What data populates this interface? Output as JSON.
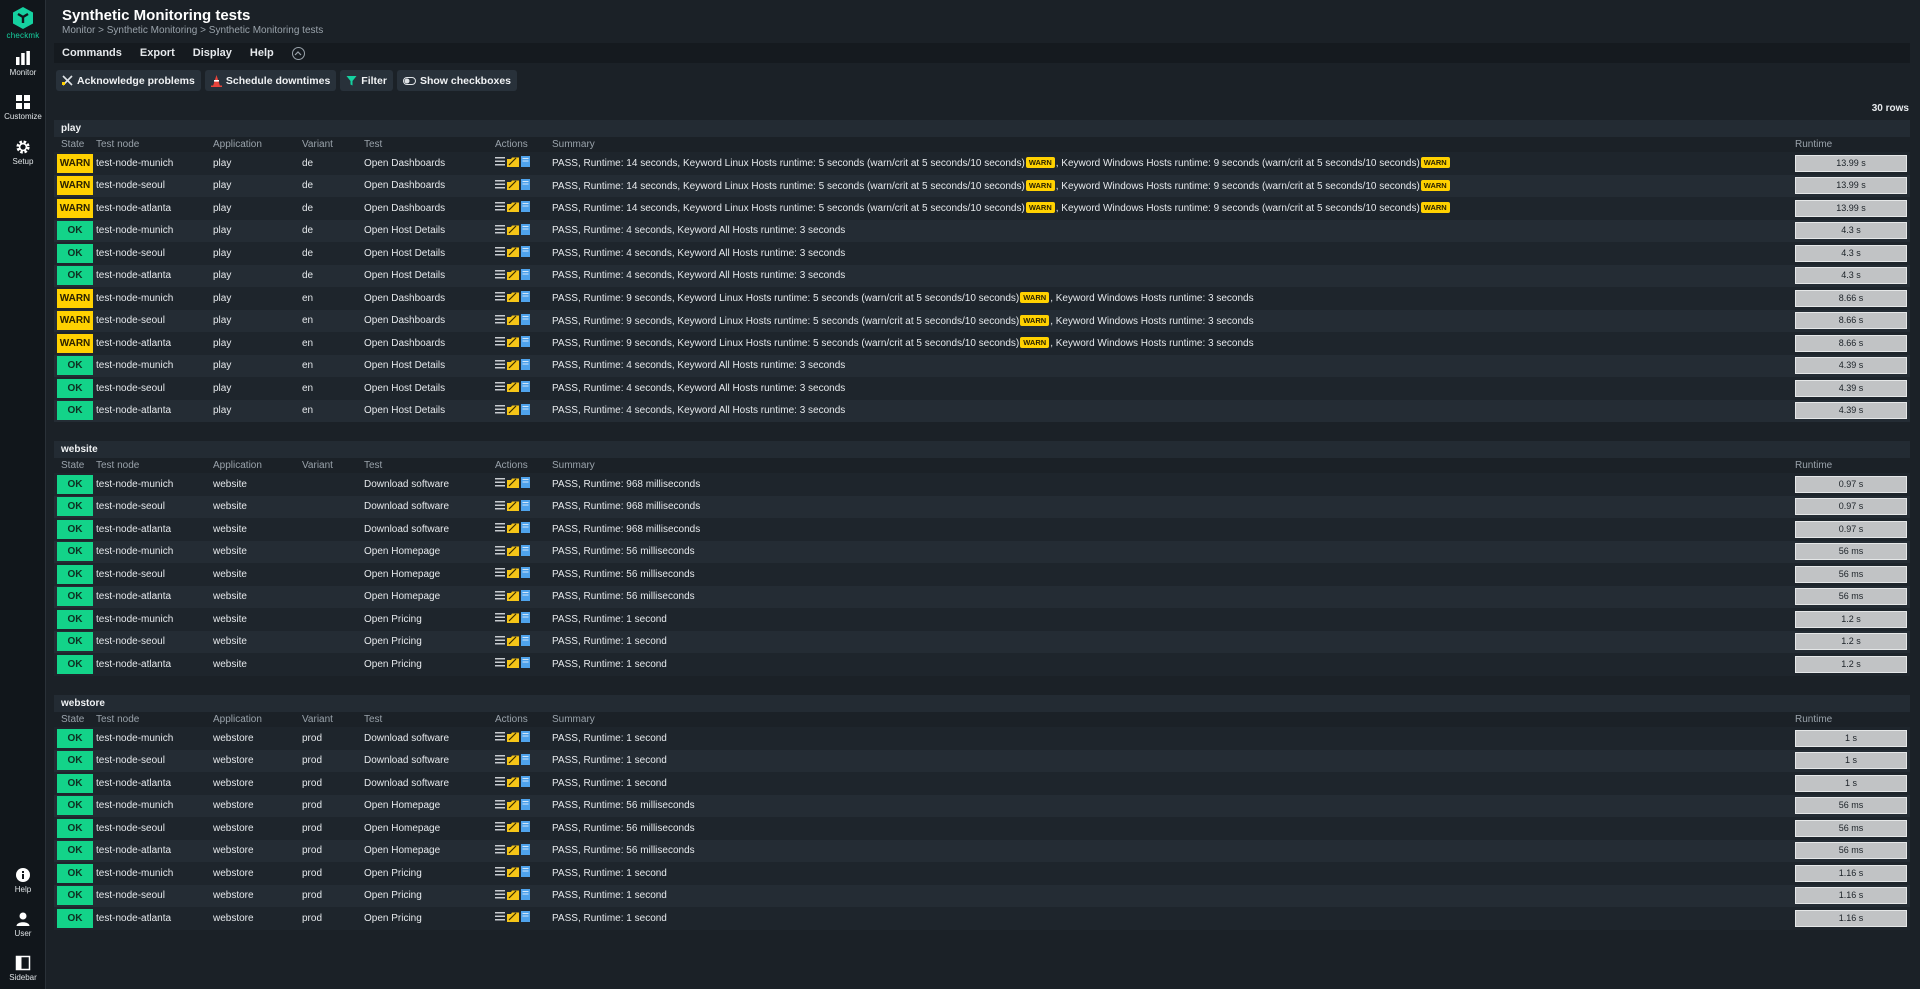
{
  "nav": {
    "logo_text": "checkmk",
    "items": [
      {
        "label": "Monitor"
      },
      {
        "label": "Customize"
      },
      {
        "label": "Setup"
      }
    ],
    "bottom_items": [
      {
        "label": "Help"
      },
      {
        "label": "User"
      },
      {
        "label": "Sidebar"
      }
    ]
  },
  "header": {
    "title": "Synthetic Monitoring tests",
    "breadcrumb": [
      "Monitor",
      "Synthetic Monitoring",
      "Synthetic Monitoring tests"
    ]
  },
  "menubar": [
    "Commands",
    "Export",
    "Display",
    "Help"
  ],
  "toolbar": [
    {
      "label": "Acknowledge problems",
      "icon": "acknowledge-icon"
    },
    {
      "label": "Schedule downtimes",
      "icon": "downtime-cone-icon"
    },
    {
      "label": "Filter",
      "icon": "filter-icon"
    },
    {
      "label": "Show checkboxes",
      "icon": "toggle-icon"
    }
  ],
  "row_count": "30 rows",
  "columns": [
    "State",
    "Test node",
    "Application",
    "Variant",
    "Test",
    "Actions",
    "Summary",
    "Runtime"
  ],
  "colors": {
    "ok": "#13d389",
    "warn": "#ffd100",
    "accent": "#15d1a0"
  },
  "groups": [
    {
      "name": "play",
      "rows": [
        {
          "state": "WARN",
          "node": "test-node-munich",
          "app": "play",
          "variant": "de",
          "test": "Open Dashboards",
          "summary": [
            "PASS, Runtime: 14 seconds, Keyword Linux Hosts runtime: 5 seconds (warn/crit at 5 seconds/10 seconds)",
            "WARN",
            ", Keyword Windows Hosts runtime: 9 seconds (warn/crit at 5 seconds/10 seconds)",
            "WARN"
          ],
          "runtime": "13.99 s"
        },
        {
          "state": "WARN",
          "node": "test-node-seoul",
          "app": "play",
          "variant": "de",
          "test": "Open Dashboards",
          "summary": [
            "PASS, Runtime: 14 seconds, Keyword Linux Hosts runtime: 5 seconds (warn/crit at 5 seconds/10 seconds)",
            "WARN",
            ", Keyword Windows Hosts runtime: 9 seconds (warn/crit at 5 seconds/10 seconds)",
            "WARN"
          ],
          "runtime": "13.99 s"
        },
        {
          "state": "WARN",
          "node": "test-node-atlanta",
          "app": "play",
          "variant": "de",
          "test": "Open Dashboards",
          "summary": [
            "PASS, Runtime: 14 seconds, Keyword Linux Hosts runtime: 5 seconds (warn/crit at 5 seconds/10 seconds)",
            "WARN",
            ", Keyword Windows Hosts runtime: 9 seconds (warn/crit at 5 seconds/10 seconds)",
            "WARN"
          ],
          "runtime": "13.99 s"
        },
        {
          "state": "OK",
          "node": "test-node-munich",
          "app": "play",
          "variant": "de",
          "test": "Open Host Details",
          "summary": [
            "PASS, Runtime: 4 seconds, Keyword All Hosts runtime: 3 seconds"
          ],
          "runtime": "4.3 s"
        },
        {
          "state": "OK",
          "node": "test-node-seoul",
          "app": "play",
          "variant": "de",
          "test": "Open Host Details",
          "summary": [
            "PASS, Runtime: 4 seconds, Keyword All Hosts runtime: 3 seconds"
          ],
          "runtime": "4.3 s"
        },
        {
          "state": "OK",
          "node": "test-node-atlanta",
          "app": "play",
          "variant": "de",
          "test": "Open Host Details",
          "summary": [
            "PASS, Runtime: 4 seconds, Keyword All Hosts runtime: 3 seconds"
          ],
          "runtime": "4.3 s"
        },
        {
          "state": "WARN",
          "node": "test-node-munich",
          "app": "play",
          "variant": "en",
          "test": "Open Dashboards",
          "summary": [
            "PASS, Runtime: 9 seconds, Keyword Linux Hosts runtime: 5 seconds (warn/crit at 5 seconds/10 seconds)",
            "WARN",
            ", Keyword Windows Hosts runtime: 3 seconds"
          ],
          "runtime": "8.66 s"
        },
        {
          "state": "WARN",
          "node": "test-node-seoul",
          "app": "play",
          "variant": "en",
          "test": "Open Dashboards",
          "summary": [
            "PASS, Runtime: 9 seconds, Keyword Linux Hosts runtime: 5 seconds (warn/crit at 5 seconds/10 seconds)",
            "WARN",
            ", Keyword Windows Hosts runtime: 3 seconds"
          ],
          "runtime": "8.66 s"
        },
        {
          "state": "WARN",
          "node": "test-node-atlanta",
          "app": "play",
          "variant": "en",
          "test": "Open Dashboards",
          "summary": [
            "PASS, Runtime: 9 seconds, Keyword Linux Hosts runtime: 5 seconds (warn/crit at 5 seconds/10 seconds)",
            "WARN",
            ", Keyword Windows Hosts runtime: 3 seconds"
          ],
          "runtime": "8.66 s"
        },
        {
          "state": "OK",
          "node": "test-node-munich",
          "app": "play",
          "variant": "en",
          "test": "Open Host Details",
          "summary": [
            "PASS, Runtime: 4 seconds, Keyword All Hosts runtime: 3 seconds"
          ],
          "runtime": "4.39 s"
        },
        {
          "state": "OK",
          "node": "test-node-seoul",
          "app": "play",
          "variant": "en",
          "test": "Open Host Details",
          "summary": [
            "PASS, Runtime: 4 seconds, Keyword All Hosts runtime: 3 seconds"
          ],
          "runtime": "4.39 s"
        },
        {
          "state": "OK",
          "node": "test-node-atlanta",
          "app": "play",
          "variant": "en",
          "test": "Open Host Details",
          "summary": [
            "PASS, Runtime: 4 seconds, Keyword All Hosts runtime: 3 seconds"
          ],
          "runtime": "4.39 s"
        }
      ]
    },
    {
      "name": "website",
      "rows": [
        {
          "state": "OK",
          "node": "test-node-munich",
          "app": "website",
          "variant": "",
          "test": "Download software",
          "summary": [
            "PASS, Runtime: 968 milliseconds"
          ],
          "runtime": "0.97 s"
        },
        {
          "state": "OK",
          "node": "test-node-seoul",
          "app": "website",
          "variant": "",
          "test": "Download software",
          "summary": [
            "PASS, Runtime: 968 milliseconds"
          ],
          "runtime": "0.97 s"
        },
        {
          "state": "OK",
          "node": "test-node-atlanta",
          "app": "website",
          "variant": "",
          "test": "Download software",
          "summary": [
            "PASS, Runtime: 968 milliseconds"
          ],
          "runtime": "0.97 s"
        },
        {
          "state": "OK",
          "node": "test-node-munich",
          "app": "website",
          "variant": "",
          "test": "Open Homepage",
          "summary": [
            "PASS, Runtime: 56 milliseconds"
          ],
          "runtime": "56 ms"
        },
        {
          "state": "OK",
          "node": "test-node-seoul",
          "app": "website",
          "variant": "",
          "test": "Open Homepage",
          "summary": [
            "PASS, Runtime: 56 milliseconds"
          ],
          "runtime": "56 ms"
        },
        {
          "state": "OK",
          "node": "test-node-atlanta",
          "app": "website",
          "variant": "",
          "test": "Open Homepage",
          "summary": [
            "PASS, Runtime: 56 milliseconds"
          ],
          "runtime": "56 ms"
        },
        {
          "state": "OK",
          "node": "test-node-munich",
          "app": "website",
          "variant": "",
          "test": "Open Pricing",
          "summary": [
            "PASS, Runtime: 1 second"
          ],
          "runtime": "1.2 s"
        },
        {
          "state": "OK",
          "node": "test-node-seoul",
          "app": "website",
          "variant": "",
          "test": "Open Pricing",
          "summary": [
            "PASS, Runtime: 1 second"
          ],
          "runtime": "1.2 s"
        },
        {
          "state": "OK",
          "node": "test-node-atlanta",
          "app": "website",
          "variant": "",
          "test": "Open Pricing",
          "summary": [
            "PASS, Runtime: 1 second"
          ],
          "runtime": "1.2 s"
        }
      ]
    },
    {
      "name": "webstore",
      "rows": [
        {
          "state": "OK",
          "node": "test-node-munich",
          "app": "webstore",
          "variant": "prod",
          "test": "Download software",
          "summary": [
            "PASS, Runtime: 1 second"
          ],
          "runtime": "1 s"
        },
        {
          "state": "OK",
          "node": "test-node-seoul",
          "app": "webstore",
          "variant": "prod",
          "test": "Download software",
          "summary": [
            "PASS, Runtime: 1 second"
          ],
          "runtime": "1 s"
        },
        {
          "state": "OK",
          "node": "test-node-atlanta",
          "app": "webstore",
          "variant": "prod",
          "test": "Download software",
          "summary": [
            "PASS, Runtime: 1 second"
          ],
          "runtime": "1 s"
        },
        {
          "state": "OK",
          "node": "test-node-munich",
          "app": "webstore",
          "variant": "prod",
          "test": "Open Homepage",
          "summary": [
            "PASS, Runtime: 56 milliseconds"
          ],
          "runtime": "56 ms"
        },
        {
          "state": "OK",
          "node": "test-node-seoul",
          "app": "webstore",
          "variant": "prod",
          "test": "Open Homepage",
          "summary": [
            "PASS, Runtime: 56 milliseconds"
          ],
          "runtime": "56 ms"
        },
        {
          "state": "OK",
          "node": "test-node-atlanta",
          "app": "webstore",
          "variant": "prod",
          "test": "Open Homepage",
          "summary": [
            "PASS, Runtime: 56 milliseconds"
          ],
          "runtime": "56 ms"
        },
        {
          "state": "OK",
          "node": "test-node-munich",
          "app": "webstore",
          "variant": "prod",
          "test": "Open Pricing",
          "summary": [
            "PASS, Runtime: 1 second"
          ],
          "runtime": "1.16 s"
        },
        {
          "state": "OK",
          "node": "test-node-seoul",
          "app": "webstore",
          "variant": "prod",
          "test": "Open Pricing",
          "summary": [
            "PASS, Runtime: 1 second"
          ],
          "runtime": "1.16 s"
        },
        {
          "state": "OK",
          "node": "test-node-atlanta",
          "app": "webstore",
          "variant": "prod",
          "test": "Open Pricing",
          "summary": [
            "PASS, Runtime: 1 second"
          ],
          "runtime": "1.16 s"
        }
      ]
    }
  ]
}
